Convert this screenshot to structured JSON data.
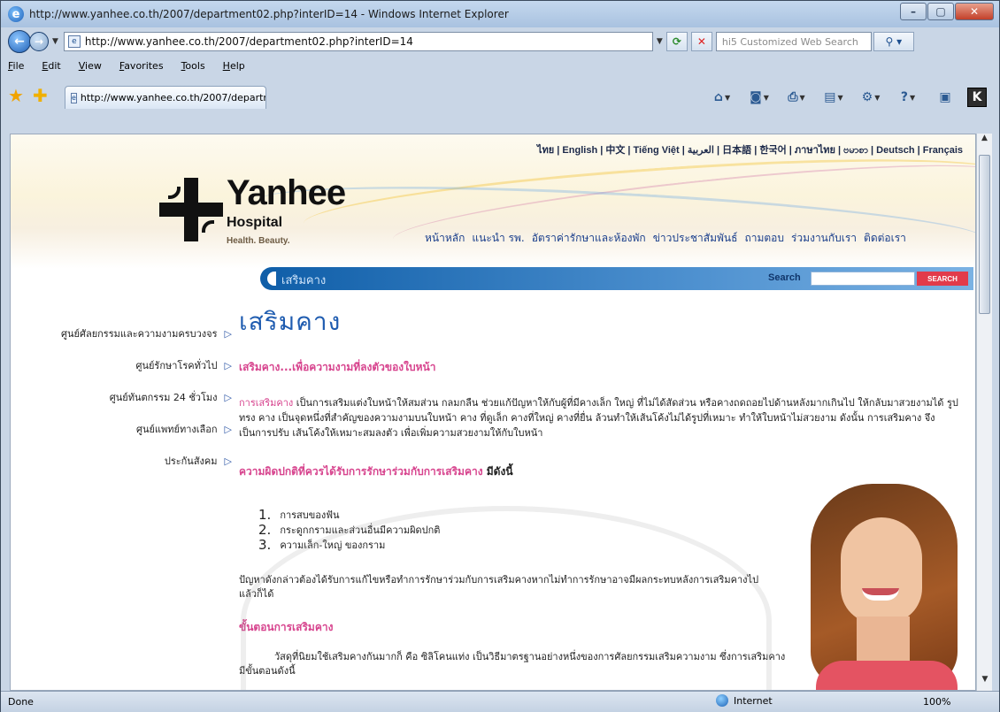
{
  "window": {
    "title": "http://www.yanhee.co.th/2007/department02.php?interID=14 - Windows Internet Explorer",
    "controls": {
      "minimize": "–",
      "maximize": "▢",
      "close": "✕"
    }
  },
  "addressbar": {
    "url": "http://www.yanhee.co.th/2007/department02.php?interID=14",
    "search_placeholder": "hi5 Customized Web Search"
  },
  "menu": [
    "File",
    "Edit",
    "View",
    "Favorites",
    "Tools",
    "Help"
  ],
  "tab": {
    "label": "http://www.yanhee.co.th/2007/department0..."
  },
  "site": {
    "languages": "ไทย | English | 中文 | Tiếng Việt | العربية | 日本語 | 한국어 | ภาษาไทย | ဗမာစာ | Deutsch | Français",
    "logo": {
      "name": "Yanhee",
      "sub": "Hospital",
      "tagline": "Health. Beauty."
    },
    "nav": [
      "หน้าหลัก",
      "แนะนำ รพ.",
      "อัตราค่ารักษาและห้องพัก",
      "ข่าวประชาสัมพันธ์",
      "ถามตอบ",
      "ร่วมงานกับเรา",
      "ติดต่อเรา"
    ],
    "section_label": "เสริมคาง",
    "search_label": "Search",
    "search_button": "SEARCH",
    "sidebar": [
      "ศูนย์ศัลยกรรมและความงามครบวงจร",
      "ศูนย์รักษาโรคทั่วไป",
      "ศูนย์ทันตกรรม 24 ชั่วโมง",
      "ศูนย์แพทย์ทางเลือก",
      "ประกันสังคม"
    ],
    "content": {
      "title": "เสริมคาง",
      "subtitle": "เสริมคาง...เพื่อความงามที่ลงตัวของใบหน้า",
      "para1_lead": "การเสริมคาง",
      "para1": " เป็นการเสริมแต่งใบหน้าให้สมส่วน กลมกลืน ช่วยแก้ปัญหาให้กับผู้ที่มีคางเล็ก ใหญ่ ที่ไม่ได้สัดส่วน หรือคางถดถอยไปด้านหลังมากเกินไป ให้กลับมาสวยงามได้ รูปทรง คาง เป็นจุดหนึ่งที่สำคัญของความงามบนใบหน้า คาง ที่ดูเล็ก คางที่ใหญ่ คางที่ยื่น ล้วนทำให้เส้นโค้งไม่ได้รูปที่เหมาะ ทำให้ใบหน้าไม่สวยงาม ดังนั้น การเสริมคาง จึงเป็นการปรับ เส้นโค้งให้เหมาะสมลงตัว เพื่อเพิ่มความสวยงามให้กับใบหน้า",
      "subtitle2": "ความผิดปกติที่ควรได้รับการรักษาร่วมกับการเสริมคาง",
      "subtitle2_tail": " มีดังนี้",
      "list": [
        {
          "num": "1.",
          "text": "การสบของฟัน"
        },
        {
          "num": "2.",
          "text": "กระดูกกรามและส่วนอื่นมีความผิดปกติ"
        },
        {
          "num": "3.",
          "text": "ความเล็ก-ใหญ่ ของกราม"
        }
      ],
      "para2": "ปัญหาดังกล่าวต้องได้รับการแก้ไขหรือทำการรักษาร่วมกับการเสริมคางหากไม่ทำการรักษาอาจมีผลกระทบหลังการเสริมคางไปแล้วก็ได้",
      "subtitle3": "ขั้นตอนการเสริมคาง",
      "para3": "วัสดุที่นิยมใช้เสริมคางกันมากก็ คือ ซิลิโคนแท่ง เป็นวิธีมาตรฐานอย่างหนึ่งของการศัลยกรรมเสริมความงาม ซึ่งการเสริมคางมีขั้นตอนดังนี้"
    }
  },
  "status": {
    "left": "Done",
    "zone": "Internet",
    "zoom": "100%"
  },
  "colors": {
    "accent_pink": "#d7448e",
    "title_blue": "#1f5cb0",
    "bar_blue": "#0f5ea8",
    "search_red": "#e23b4b"
  }
}
